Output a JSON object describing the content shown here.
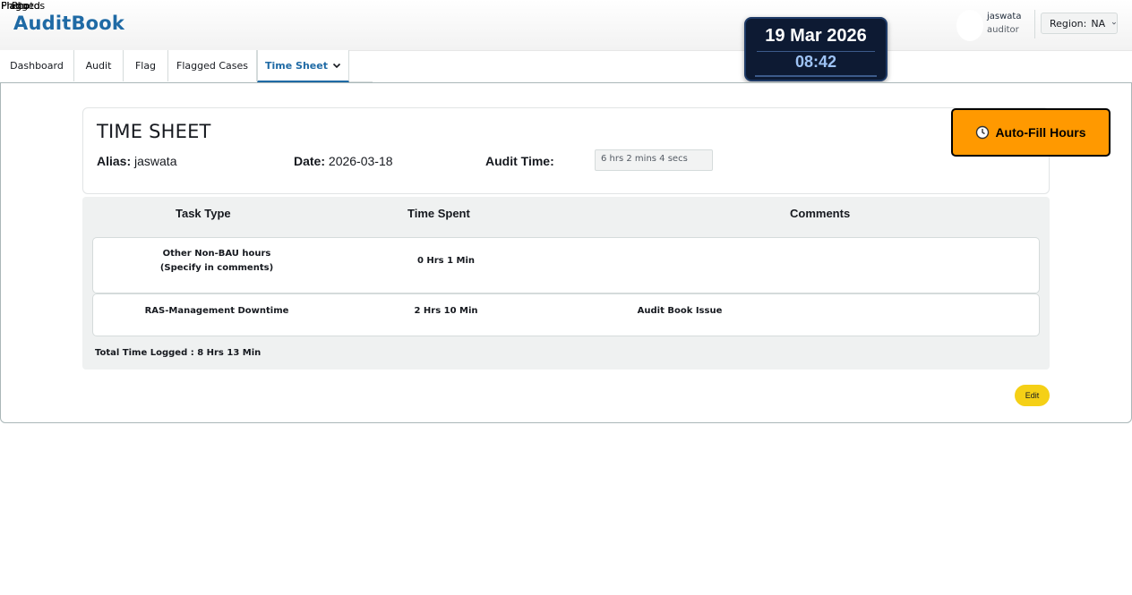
{
  "overlap_texts": [
    "Photos",
    "Photo",
    "Flag",
    "Flagged"
  ],
  "header": {
    "brand": "AuditBook",
    "user": {
      "name": "jaswata",
      "role": "auditor"
    },
    "region": {
      "label": "Region:",
      "value": "NA"
    }
  },
  "clock": {
    "date": "19 Mar 2026",
    "time": "08:42"
  },
  "tabs": [
    {
      "label": "Dashboard"
    },
    {
      "label": "Audit"
    },
    {
      "label": "Flag"
    },
    {
      "label": "Flagged Cases"
    },
    {
      "label": "Time Sheet",
      "active": true
    }
  ],
  "timesheet": {
    "title": "TIME SHEET",
    "alias_label": "Alias:",
    "alias_value": "jaswata",
    "date_label": "Date:",
    "date_value": "2026-03-18",
    "audit_time_label": "Audit Time:",
    "audit_time_value": "6 hrs 2 mins 4 secs",
    "autofill_label": "Auto-Fill Hours"
  },
  "table": {
    "headers": [
      "Task Type",
      "Time Spent",
      "Comments"
    ],
    "rows": [
      {
        "task_line1": "Other Non-BAU hours",
        "task_line2": "(Specify in comments)",
        "time": "0 Hrs 1 Min",
        "comment": ""
      },
      {
        "task_line1": "RAS-Management Downtime",
        "task_line2": "",
        "time": "2 Hrs 10 Min",
        "comment": "Audit Book Issue"
      }
    ],
    "total": "Total Time Logged : 8 Hrs 13 Min"
  },
  "edit_label": "Edit",
  "colors": {
    "brand": "#1f6aa5",
    "autofill": "#ff9900",
    "edit": "#f5d016",
    "clock_bg": "#0d1a33"
  }
}
